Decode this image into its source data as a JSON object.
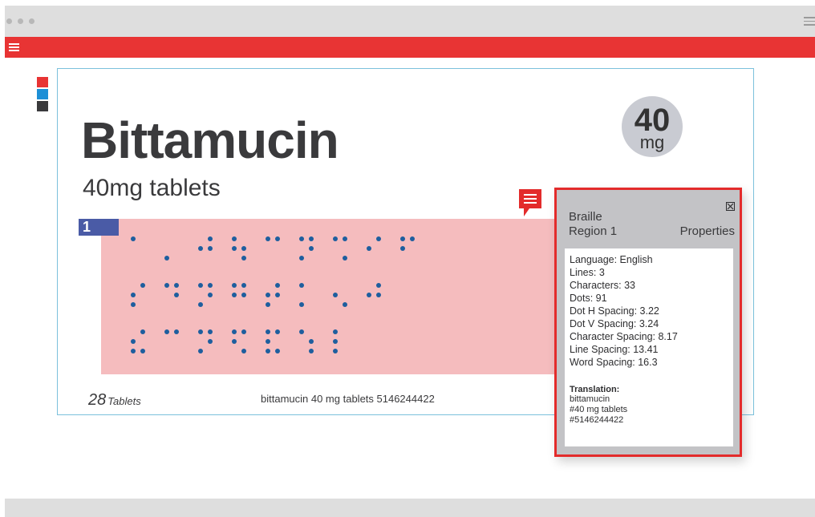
{
  "colors": {
    "accent_red": "#e83434",
    "frame_blue": "#7cc1dc",
    "region_fill": "#f5bcbe",
    "badge_blue": "#4a5ba6",
    "dot_blue": "#1e5e9e",
    "swatches": [
      "#e83434",
      "#1d8fd6",
      "#3a3a3c"
    ]
  },
  "toolbar": {
    "menu_icon": "hamburger-icon"
  },
  "label": {
    "product_name": "Bittamucin",
    "product_sub": "40mg tablets",
    "dose_value": "40",
    "dose_unit": "mg",
    "tablet_count": "28",
    "tablet_word": "Tablets",
    "footer_text": "bittamucin 40 mg tablets 5146244422"
  },
  "region": {
    "number": "1",
    "comment_icon": "comment-icon",
    "braille_rows": [
      [
        [
          [
            1,
            0
          ],
          [
            0,
            0
          ],
          [
            0,
            0
          ]
        ],
        [
          [
            0,
            0
          ],
          [
            0,
            0
          ],
          [
            1,
            0
          ]
        ],
        [
          [
            0,
            1
          ],
          [
            1,
            1
          ],
          [
            0,
            0
          ]
        ],
        [
          [
            1,
            0
          ],
          [
            1,
            1
          ],
          [
            0,
            1
          ]
        ],
        [
          [
            1,
            1
          ],
          [
            0,
            0
          ],
          [
            0,
            0
          ]
        ],
        [
          [
            1,
            1
          ],
          [
            0,
            1
          ],
          [
            1,
            0
          ]
        ],
        [
          [
            1,
            1
          ],
          [
            0,
            0
          ],
          [
            0,
            1
          ]
        ],
        [
          [
            0,
            1
          ],
          [
            1,
            0
          ],
          [
            0,
            0
          ]
        ],
        [
          [
            1,
            1
          ],
          [
            1,
            0
          ],
          [
            0,
            0
          ]
        ]
      ],
      [
        [
          [
            0,
            1
          ],
          [
            1,
            0
          ],
          [
            1,
            0
          ]
        ],
        [
          [
            1,
            1
          ],
          [
            0,
            1
          ],
          [
            0,
            0
          ]
        ],
        [
          [
            1,
            1
          ],
          [
            0,
            1
          ],
          [
            1,
            0
          ]
        ],
        [
          [
            1,
            1
          ],
          [
            1,
            1
          ],
          [
            0,
            0
          ]
        ],
        [
          [
            0,
            1
          ],
          [
            1,
            1
          ],
          [
            1,
            0
          ]
        ],
        [
          [
            1,
            0
          ],
          [
            0,
            0
          ],
          [
            1,
            0
          ]
        ],
        [
          [
            0,
            0
          ],
          [
            1,
            0
          ],
          [
            0,
            1
          ]
        ],
        [
          [
            0,
            1
          ],
          [
            1,
            1
          ],
          [
            0,
            0
          ]
        ]
      ],
      [
        [
          [
            0,
            1
          ],
          [
            1,
            0
          ],
          [
            1,
            1
          ]
        ],
        [
          [
            1,
            1
          ],
          [
            0,
            0
          ],
          [
            0,
            0
          ]
        ],
        [
          [
            1,
            1
          ],
          [
            0,
            1
          ],
          [
            1,
            0
          ]
        ],
        [
          [
            1,
            1
          ],
          [
            1,
            0
          ],
          [
            0,
            1
          ]
        ],
        [
          [
            1,
            1
          ],
          [
            1,
            0
          ],
          [
            1,
            1
          ]
        ],
        [
          [
            1,
            0
          ],
          [
            0,
            1
          ],
          [
            0,
            1
          ]
        ],
        [
          [
            1,
            0
          ],
          [
            1,
            0
          ],
          [
            1,
            0
          ]
        ]
      ]
    ]
  },
  "panel": {
    "close_icon": "close-box-icon",
    "title_line1": "Braille",
    "title_line2": "Region 1",
    "title_right": "Properties",
    "properties": [
      "Language: English",
      "Lines: 3",
      "Characters: 33",
      "Dots: 91",
      "Dot H Spacing: 3.22",
      "Dot V Spacing: 3.24",
      "Character Spacing: 8.17",
      "Line Spacing: 13.41",
      "Word Spacing: 16.3"
    ],
    "translation_label": "Translation:",
    "translation_lines": [
      "bittamucin",
      "#40 mg tablets",
      "#5146244422"
    ]
  }
}
